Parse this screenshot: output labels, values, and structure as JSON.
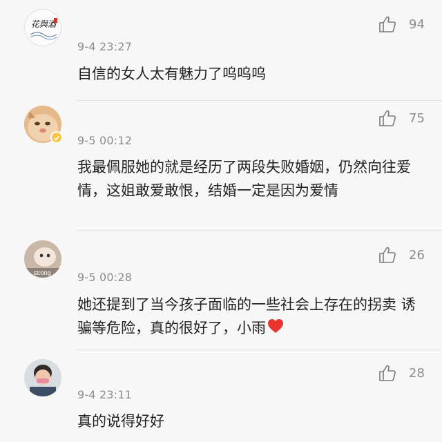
{
  "comments": [
    {
      "avatar": "avatar-calligraphy-seal",
      "avatar_text": "花與酒",
      "time": "9-4 23:27",
      "text": "自信的女人太有魅力了呜呜呜",
      "likes": "94"
    },
    {
      "avatar": "avatar-cat",
      "verified_badge": true,
      "time": "9-5 00:12",
      "text": "我最佩服她的就是经历了两段失败婚姻，仍然向往爱情，这姐敢爱敢恨，结婚一定是因为爱情",
      "likes": "75"
    },
    {
      "avatar": "avatar-strong-photo",
      "avatar_text": "strong",
      "time": "9-5 00:28",
      "text": "她还提到了当今孩子面临的一些社会上存在的拐卖 诱骗等危险，真的很好了，小雨",
      "trailing_icon": "red-heart-emoji",
      "likes": "26"
    },
    {
      "avatar": "avatar-child-photo",
      "time": "9-4 23:11",
      "text": "真的说得好好",
      "likes": "28"
    }
  ],
  "colors": {
    "background": "#f7f7f7",
    "text": "#222222",
    "meta": "#8c8c8c",
    "heart": "#e8352f",
    "badge": "#f6c343"
  }
}
